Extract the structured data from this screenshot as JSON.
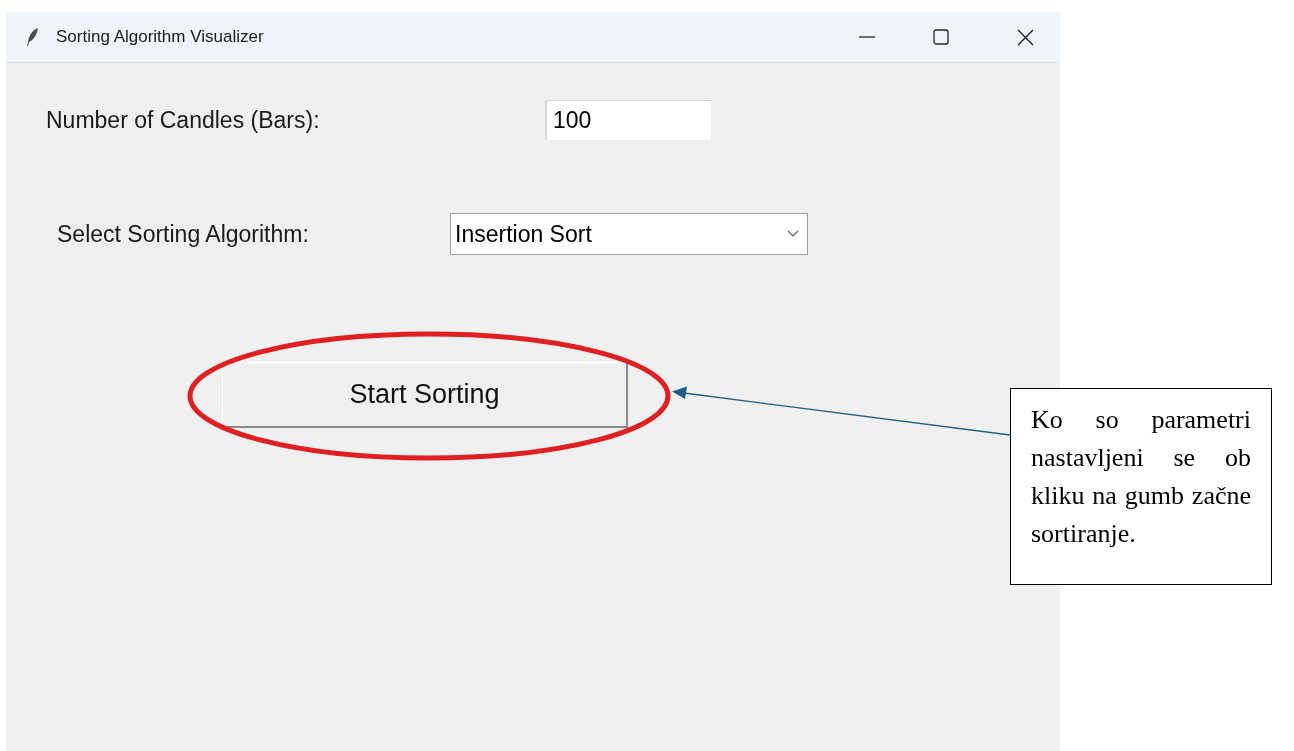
{
  "window": {
    "title": "Sorting Algorithm Visualizer"
  },
  "form": {
    "count_label": "Number of Candles (Bars):",
    "count_value": "100",
    "algorithm_label": "Select Sorting Algorithm:",
    "algorithm_value": "Insertion Sort"
  },
  "start_button": {
    "label": "Start Sorting"
  },
  "annotation": {
    "text": "Ko so parametri nastavljeni se ob kliku na gumb začne sortiranje."
  }
}
